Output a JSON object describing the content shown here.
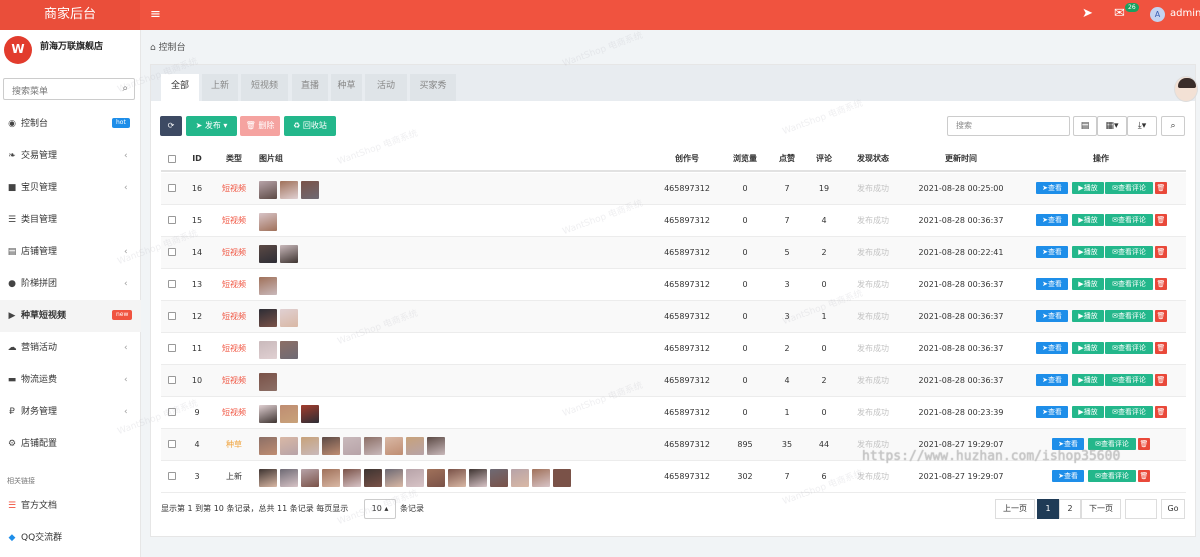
{
  "app": {
    "title": "商家后台",
    "user": "admin",
    "user_initial": "A",
    "msg_count": "26"
  },
  "sidebar": {
    "shop_name": "前海万联旗舰店",
    "search_placeholder": "搜索菜单",
    "items": [
      {
        "label": "控制台",
        "icon": "dashboard-icon",
        "badge": "hot",
        "badge_color": "#1e8ee9"
      },
      {
        "label": "交易管理",
        "icon": "leaf-icon",
        "arrow": "‹"
      },
      {
        "label": "宝贝管理",
        "icon": "gift-icon",
        "arrow": "‹"
      },
      {
        "label": "类目管理",
        "icon": "list-icon"
      },
      {
        "label": "店铺管理",
        "icon": "shop-icon",
        "arrow": "‹"
      },
      {
        "label": "阶梯拼团",
        "icon": "group-icon",
        "arrow": "‹"
      },
      {
        "label": "种草短视频",
        "icon": "video-icon",
        "badge": "new",
        "badge_color": "#f0533f"
      },
      {
        "label": "营销活动",
        "icon": "cloud-icon",
        "arrow": "‹"
      },
      {
        "label": "物流运费",
        "icon": "truck-icon",
        "arrow": "‹"
      },
      {
        "label": "财务管理",
        "icon": "ruble-icon",
        "arrow": "‹"
      },
      {
        "label": "店铺配置",
        "icon": "gear-icon"
      }
    ],
    "section_title": "相关链接",
    "links": [
      {
        "label": "官方文档",
        "icon": "doc-icon"
      },
      {
        "label": "QQ交流群",
        "icon": "qq-icon"
      }
    ]
  },
  "breadcrumb": "控制台",
  "tabs": [
    "全部",
    "上新",
    "短视频",
    "直播",
    "种草",
    "活动",
    "买家秀"
  ],
  "toolbar": {
    "publish": "发布",
    "delete": "删除",
    "recycle": "回收站",
    "search_placeholder": "搜索"
  },
  "table": {
    "columns": [
      "ID",
      "类型",
      "图片组",
      "创作号",
      "浏览量",
      "点赞",
      "评论",
      "发现状态",
      "更新时间",
      "操作"
    ],
    "actions": {
      "view": "查看",
      "play": "播放",
      "comments": "查看评论"
    },
    "rows": [
      {
        "id": "16",
        "type": "短视频",
        "kind": "video",
        "thumbs": 3,
        "creator": "465897312",
        "views": "0",
        "likes": "7",
        "comments": "19",
        "status": "发布成功",
        "time": "2021-08-28 00:25:00"
      },
      {
        "id": "15",
        "type": "短视频",
        "kind": "video",
        "thumbs": 1,
        "creator": "465897312",
        "views": "0",
        "likes": "7",
        "comments": "4",
        "status": "发布成功",
        "time": "2021-08-28 00:36:37"
      },
      {
        "id": "14",
        "type": "短视频",
        "kind": "video",
        "thumbs": 2,
        "creator": "465897312",
        "views": "0",
        "likes": "5",
        "comments": "2",
        "status": "发布成功",
        "time": "2021-08-28 00:22:41"
      },
      {
        "id": "13",
        "type": "短视频",
        "kind": "video",
        "thumbs": 1,
        "creator": "465897312",
        "views": "0",
        "likes": "3",
        "comments": "0",
        "status": "发布成功",
        "time": "2021-08-28 00:36:37"
      },
      {
        "id": "12",
        "type": "短视频",
        "kind": "video",
        "thumbs": 2,
        "creator": "465897312",
        "views": "0",
        "likes": "3",
        "comments": "1",
        "status": "发布成功",
        "time": "2021-08-28 00:36:37"
      },
      {
        "id": "11",
        "type": "短视频",
        "kind": "video",
        "thumbs": 2,
        "creator": "465897312",
        "views": "0",
        "likes": "2",
        "comments": "0",
        "status": "发布成功",
        "time": "2021-08-28 00:36:37"
      },
      {
        "id": "10",
        "type": "短视频",
        "kind": "video",
        "thumbs": 1,
        "creator": "465897312",
        "views": "0",
        "likes": "4",
        "comments": "2",
        "status": "发布成功",
        "time": "2021-08-28 00:36:37"
      },
      {
        "id": "9",
        "type": "短视频",
        "kind": "video",
        "thumbs": 3,
        "creator": "465897312",
        "views": "0",
        "likes": "1",
        "comments": "0",
        "status": "发布成功",
        "time": "2021-08-28 00:23:39"
      },
      {
        "id": "4",
        "type": "种草",
        "kind": "seed",
        "thumbs": 9,
        "creator": "465897312",
        "views": "895",
        "likes": "35",
        "comments": "44",
        "status": "发布成功",
        "time": "2021-08-27 19:29:07"
      },
      {
        "id": "3",
        "type": "上新",
        "kind": "new",
        "thumbs": 15,
        "creator": "465897312",
        "views": "302",
        "likes": "7",
        "comments": "6",
        "status": "发布成功",
        "time": "2021-08-27 19:29:07"
      }
    ]
  },
  "footer": {
    "summary": "显示第 1 到第 10 条记录，总共 11 条记录 每页显示",
    "page_size": "10",
    "summary_end": "条记录",
    "prev": "上一页",
    "next": "下一页",
    "pages": [
      "1",
      "2"
    ],
    "go": "Go"
  },
  "watermark": "WantShop 电商系统",
  "overlay_url": "https://www.huzhan.com/ishop35600",
  "colors": {
    "topbar": "#f0533f",
    "primary": "#1e8ee9",
    "success": "#23b78b",
    "danger": "#e9493a"
  }
}
